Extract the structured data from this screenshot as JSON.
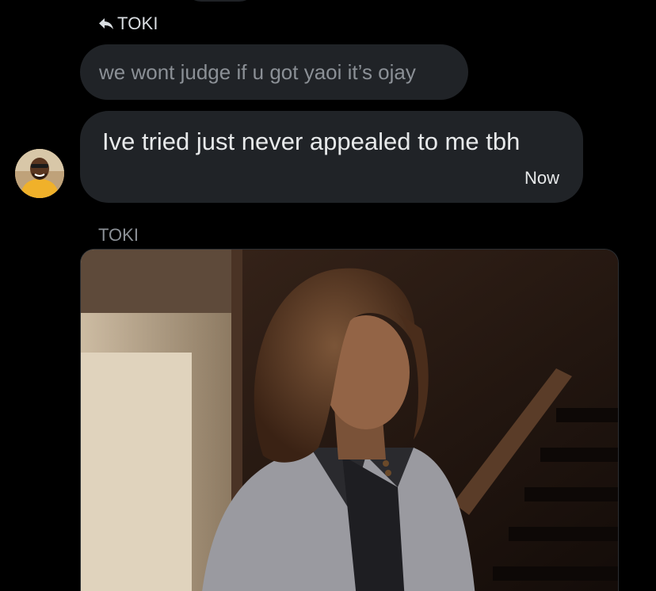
{
  "reply": {
    "icon": "reply-arrow-icon",
    "label": "TOKI"
  },
  "quoted_message": {
    "text": "we wont judge if u got yaoi it’s ojay"
  },
  "message": {
    "text": "Ive tried just never appealed to me tbh",
    "time": "Now"
  },
  "media": {
    "sender_label": "TOKI",
    "type": "video-gif"
  },
  "colors": {
    "background": "#000000",
    "bubble": "#202327",
    "text_primary": "#e7e9ea",
    "text_muted": "#8b9096"
  }
}
